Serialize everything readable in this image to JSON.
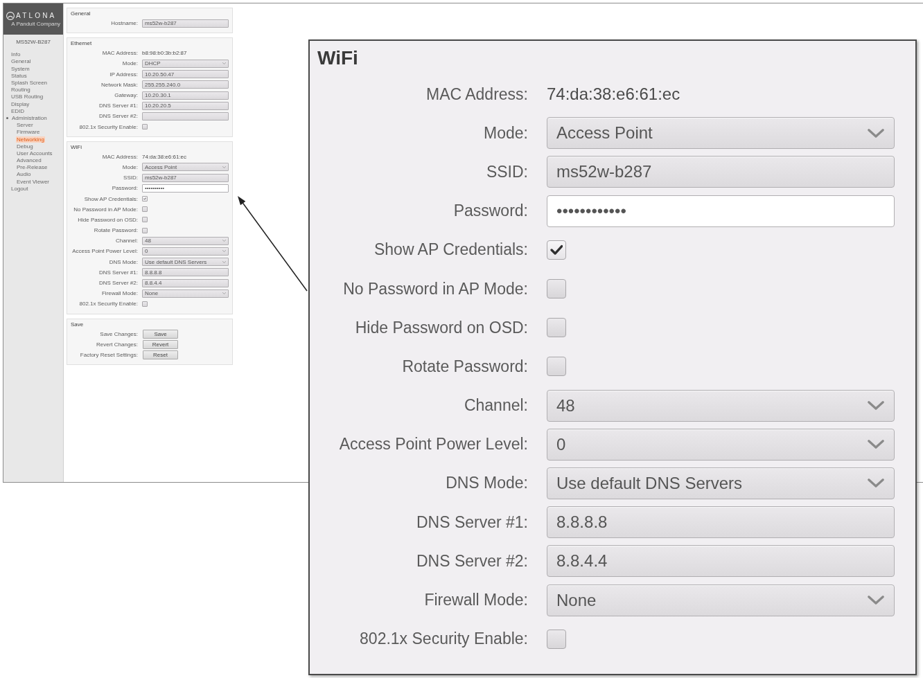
{
  "sidebar": {
    "logo": {
      "brand": "ATLONA",
      "tagline": "A Panduit Company"
    },
    "device_name": "MS52W-B287",
    "items": [
      {
        "label": "Info",
        "selected": false
      },
      {
        "label": "General",
        "selected": false
      },
      {
        "label": "System",
        "selected": false
      },
      {
        "label": "Status",
        "selected": false
      },
      {
        "label": "Splash Screen",
        "selected": false
      },
      {
        "label": "Routing",
        "selected": false
      },
      {
        "label": "USB Routing",
        "selected": false
      },
      {
        "label": "Display",
        "selected": false
      },
      {
        "label": "EDID",
        "selected": false
      },
      {
        "label": "Administration",
        "selected": false,
        "expanded": true,
        "children": [
          {
            "label": "Server",
            "selected": false
          },
          {
            "label": "Firmware",
            "selected": false
          },
          {
            "label": "Networking",
            "selected": true
          },
          {
            "label": "Debug",
            "selected": false
          },
          {
            "label": "User Accounts",
            "selected": false
          },
          {
            "label": "Advanced",
            "selected": false
          },
          {
            "label": "Pre-Release",
            "selected": false
          },
          {
            "label": "Audio",
            "selected": false
          },
          {
            "label": "Event Viewer",
            "selected": false
          }
        ]
      },
      {
        "label": "Logout",
        "selected": false
      }
    ]
  },
  "sections": [
    {
      "title": "General",
      "rows": [
        {
          "kind": "text_field",
          "label": "Hostname:",
          "value": "ms52w-b287"
        }
      ]
    },
    {
      "title": "Ethernet",
      "rows": [
        {
          "kind": "static",
          "label": "MAC Address:",
          "value": "b8:98:b0:3b:b2:87"
        },
        {
          "kind": "dropdown",
          "label": "Mode:",
          "value": "DHCP"
        },
        {
          "kind": "text_field",
          "label": "IP Address:",
          "value": "10.20.50.47"
        },
        {
          "kind": "text_field",
          "label": "Network Mask:",
          "value": "255.255.240.0"
        },
        {
          "kind": "text_field",
          "label": "Gateway:",
          "value": "10.20.30.1"
        },
        {
          "kind": "text_field",
          "label": "DNS Server #1:",
          "value": "10.20.20.5"
        },
        {
          "kind": "text_field",
          "label": "DNS Server #2:"
        },
        {
          "kind": "checkbox",
          "label": "802.1x Security Enable:",
          "checked": false
        }
      ]
    },
    {
      "title": "WiFi",
      "rows": [
        {
          "kind": "static",
          "label": "MAC Address:",
          "value": "74:da:38:e6:61:ec"
        },
        {
          "kind": "dropdown",
          "label": "Mode:",
          "value": "Access Point"
        },
        {
          "kind": "text_field",
          "label": "SSID:",
          "value": "ms52w-b287"
        },
        {
          "kind": "password",
          "label": "Password:",
          "value": "••••••••••"
        },
        {
          "kind": "checkbox",
          "label": "Show AP Credentials:",
          "checked": true
        },
        {
          "kind": "checkbox",
          "label": "No Password in AP Mode:",
          "checked": false
        },
        {
          "kind": "checkbox",
          "label": "Hide Password on OSD:",
          "checked": false
        },
        {
          "kind": "checkbox",
          "label": "Rotate Password:",
          "checked": false
        },
        {
          "kind": "dropdown",
          "label": "Channel:",
          "value": "48"
        },
        {
          "kind": "dropdown",
          "label": "Access Point Power Level:",
          "value": "0"
        },
        {
          "kind": "dropdown",
          "label": "DNS Mode:",
          "value": "Use default DNS Servers"
        },
        {
          "kind": "text_field",
          "label": "DNS Server #1:",
          "value": "8.8.8.8"
        },
        {
          "kind": "text_field",
          "label": "DNS Server #2:",
          "value": "8.8.4.4"
        },
        {
          "kind": "dropdown",
          "label": "Firewall Mode:",
          "value": "None"
        },
        {
          "kind": "checkbox",
          "label": "802.1x Security Enable:",
          "checked": false
        }
      ]
    },
    {
      "title": "Save",
      "rows": [
        {
          "kind": "button",
          "label": "Save Changes:",
          "button": "Save"
        },
        {
          "kind": "button",
          "label": "Revert Changes:",
          "button": "Revert"
        },
        {
          "kind": "button",
          "label": "Factory Reset Settings:",
          "button": "Reset"
        }
      ]
    }
  ],
  "callout": {
    "title": "WiFi",
    "rows": [
      {
        "kind": "static",
        "label": "MAC Address:",
        "value": "74:da:38:e6:61:ec"
      },
      {
        "kind": "dropdown",
        "label": "Mode:",
        "value": "Access Point"
      },
      {
        "kind": "text_field",
        "label": "SSID:",
        "value": "ms52w-b287"
      },
      {
        "kind": "password",
        "label": "Password:",
        "value": "••••••••••••"
      },
      {
        "kind": "checkbox",
        "label": "Show AP Credentials:",
        "checked": true
      },
      {
        "kind": "checkbox",
        "label": "No Password in AP Mode:",
        "checked": false
      },
      {
        "kind": "checkbox",
        "label": "Hide Password on OSD:",
        "checked": false
      },
      {
        "kind": "checkbox",
        "label": "Rotate Password:",
        "checked": false
      },
      {
        "kind": "dropdown",
        "label": "Channel:",
        "value": "48"
      },
      {
        "kind": "dropdown",
        "label": "Access Point Power Level:",
        "value": "0"
      },
      {
        "kind": "dropdown",
        "label": "DNS Mode:",
        "value": "Use default DNS Servers"
      },
      {
        "kind": "text_field",
        "label": "DNS Server #1:",
        "value": "8.8.8.8"
      },
      {
        "kind": "text_field",
        "label": "DNS Server #2:",
        "value": "8.8.4.4"
      },
      {
        "kind": "dropdown",
        "label": "Firewall Mode:",
        "value": "None"
      },
      {
        "kind": "checkbox",
        "label": "802.1x Security Enable:",
        "checked": false
      }
    ]
  }
}
